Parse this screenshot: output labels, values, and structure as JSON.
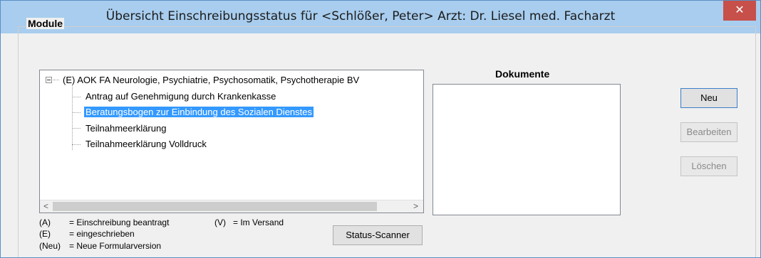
{
  "window": {
    "title": "Übersicht Einschreibungsstatus für <Schlößer, Peter> Arzt: Dr. Liesel med. Facharzt",
    "close_glyph": "✕"
  },
  "module_group": {
    "label": "Module",
    "tree": {
      "root": "(E) AOK FA Neurologie, Psychiatrie, Psychosomatik, Psychotherapie BV",
      "children": [
        "Antrag auf Genehmigung durch Krankenkasse",
        "Beratungsbogen zur Einbindung des Sozialen Dienstes",
        "Teilnahmeerklärung",
        "Teilnahmeerklärung Volldruck"
      ],
      "selected_child": "Beratungsbogen zur Einbindung des Sozialen Dienstes"
    },
    "scroll_left": "<",
    "scroll_right": ">"
  },
  "legend": {
    "a_key": "(A)",
    "a_text": "= Einschreibung beantragt",
    "v_key": "(V)",
    "v_text": "= Im Versand",
    "e_key": "(E)",
    "e_text": "= eingeschrieben",
    "neu_key": "(Neu)",
    "neu_text": "= Neue Formularversion"
  },
  "buttons": {
    "status_scanner": "Status-Scanner",
    "neu": "Neu",
    "bearbeiten": "Bearbeiten",
    "loeschen": "Löschen"
  },
  "documents": {
    "label": "Dokumente"
  },
  "colors": {
    "selection": "#3399ff",
    "titlebar": "#a8cdee",
    "close": "#c7504a"
  }
}
